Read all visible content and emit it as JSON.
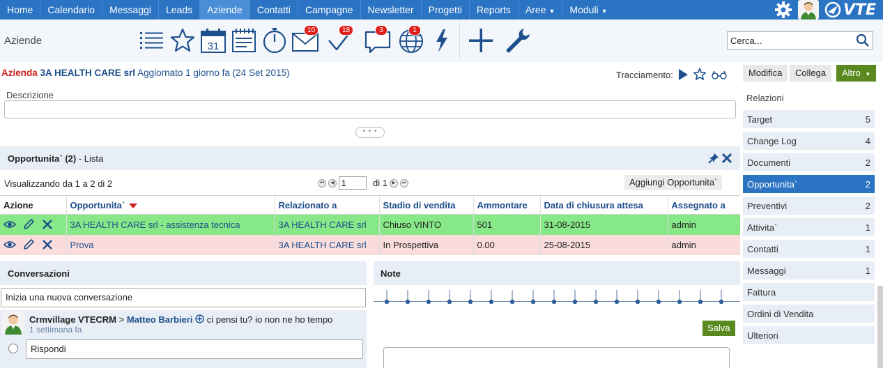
{
  "nav": {
    "items": [
      {
        "label": "Home"
      },
      {
        "label": "Calendario"
      },
      {
        "label": "Messaggi"
      },
      {
        "label": "Leads"
      },
      {
        "label": "Aziende",
        "active": true
      },
      {
        "label": "Contatti"
      },
      {
        "label": "Campagne"
      },
      {
        "label": "Newsletter"
      },
      {
        "label": "Progetti"
      },
      {
        "label": "Reports"
      },
      {
        "label": "Aree",
        "dropdown": true
      },
      {
        "label": "Moduli",
        "dropdown": true
      }
    ],
    "logo_text": "VTE",
    "icons": [
      "gear-icon",
      "user-avatar-icon",
      "vte-logo"
    ]
  },
  "toolbar": {
    "module_name": "Aziende",
    "calendar_day": "31",
    "badges": {
      "messages": "10",
      "todos": "18",
      "conversations": "3",
      "web": "1"
    },
    "search_placeholder": "Cerca..."
  },
  "record": {
    "module": "Azienda",
    "name": "3A HEALTH CARE srl",
    "updated": "Aggiornato 1 giorno fa (24 Set 2015)",
    "tracking_label": "Tracciamento:",
    "buttons": {
      "edit": "Modifica",
      "link": "Collega",
      "more": "Altro"
    }
  },
  "description": {
    "label": "Descrizione"
  },
  "opportunities": {
    "title": "Opportunita`",
    "count": "(2)",
    "view_label": "- Lista",
    "viewing": "Visualizzando da 1 a 2 di 2",
    "page_value": "1",
    "of_pages": "di 1",
    "add_button": "Aggiungi Opportunita`",
    "columns": [
      "Azione",
      "Opportunita`",
      "Relazionato a",
      "Stadio di vendita",
      "Ammontare",
      "Data di chiusura attesa",
      "Assegnato a"
    ],
    "rows": [
      {
        "name": "3A HEALTH CARE srl - assistenza tecnica",
        "related": "3A HEALTH CARE srl",
        "stage": "Chiuso VINTO",
        "amount": "501",
        "close_date": "31-08-2015",
        "assigned": "admin",
        "status": "won"
      },
      {
        "name": "Prova",
        "related": "3A HEALTH CARE srl",
        "stage": "In Prospettiva",
        "amount": "0.00",
        "close_date": "25-08-2015",
        "assigned": "admin",
        "status": "open"
      }
    ]
  },
  "conversations": {
    "title": "Conversazioni",
    "new_placeholder": "Inizia una nuova conversazione",
    "post": {
      "author": "Crmvillage VTECRM",
      "separator": ">",
      "recipient": "Matteo Barbieri",
      "message": "ci pensi tu? io non ne ho tempo",
      "time": "1 settimana fa",
      "reply_placeholder": "Rispondi"
    }
  },
  "notes": {
    "title": "Note",
    "save_button": "Salva"
  },
  "related": {
    "title": "Relazioni",
    "items": [
      {
        "label": "Target",
        "count": "5"
      },
      {
        "label": "Change Log",
        "count": "4"
      },
      {
        "label": "Documenti",
        "count": "2"
      },
      {
        "label": "Opportunita`",
        "count": "2",
        "active": true
      },
      {
        "label": "Preventivi",
        "count": "2"
      },
      {
        "label": "Attivita`",
        "count": "1"
      },
      {
        "label": "Contatti",
        "count": "1"
      },
      {
        "label": "Messaggi",
        "count": "1"
      },
      {
        "label": "Fattura",
        "count": ""
      },
      {
        "label": "Ordini di Vendita",
        "count": ""
      },
      {
        "label": "Ulteriori",
        "count": ""
      }
    ]
  },
  "colors": {
    "nav_bg": "#2b73c3",
    "accent_red": "#c9211e",
    "link_blue": "#1d4f8c",
    "won_row": "#86e886",
    "open_row": "#fbdcdc",
    "save_green": "#5a8a1f"
  }
}
